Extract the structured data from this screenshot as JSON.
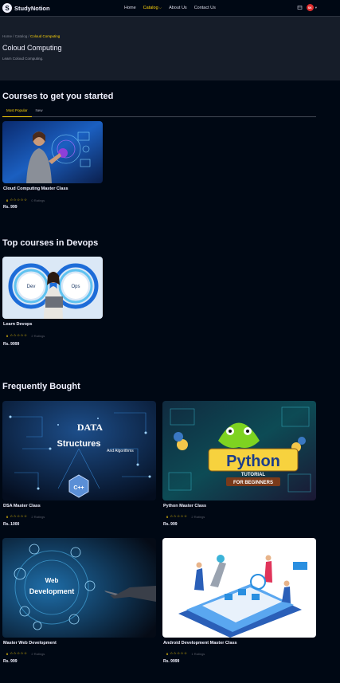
{
  "nav": {
    "logo_mark": "S",
    "logo_text": "StudyNotion",
    "links": [
      {
        "label": "Home"
      },
      {
        "label": "Catalog",
        "caret": "⌵"
      },
      {
        "label": "About Us"
      },
      {
        "label": "Contact Us"
      }
    ],
    "cart_icon": "cart-icon",
    "avatar_initials": "SK",
    "avatar_color": "#E02E2E"
  },
  "hero": {
    "breadcrumb_prefix": "Home / Catalog /",
    "breadcrumb_current": "Coloud Computing",
    "title": "Coloud Computing",
    "description": "Learn Coloud Computing."
  },
  "section1": {
    "title": "Courses to get you started",
    "tabs": [
      "Most Popular",
      "New"
    ],
    "active_tab": "Most Popular",
    "courses": [
      {
        "title": "Cloud Computing Master Class",
        "rating": "0",
        "stars": "☆☆☆☆☆",
        "ratings_text": "0 Ratings",
        "price": "Rs. 999"
      }
    ]
  },
  "section2": {
    "title": "Top courses in Devops",
    "courses": [
      {
        "title": "Learn Devops",
        "rating": "0",
        "stars": "☆☆☆☆☆",
        "ratings_text": "2 Ratings",
        "price": "Rs. 9999",
        "img_labels": [
          "Dev",
          "Ops"
        ]
      }
    ]
  },
  "section3": {
    "title": "Frequently Bought",
    "courses": [
      {
        "title": "DSA Master Class",
        "rating": "0",
        "stars": "☆☆☆☆☆",
        "ratings_text": "2 Ratings",
        "price": "Rs. 1000",
        "img_labels": [
          "DATA",
          "Structures",
          "And Algorithms",
          "C++"
        ]
      },
      {
        "title": "Python Master Class",
        "rating": "0",
        "stars": "☆☆☆☆☆",
        "ratings_text": "2 Ratings",
        "price": "Rs. 999",
        "img_labels": [
          "Python",
          "TUTORIAL",
          "FOR BEGINNERS"
        ]
      },
      {
        "title": "Master Web Development",
        "rating": "0",
        "stars": "☆☆☆☆☆",
        "ratings_text": "2 Ratings",
        "price": "Rs. 999",
        "img_labels": [
          "Web",
          "Development"
        ]
      },
      {
        "title": "Android Development Master Class",
        "rating": "0",
        "stars": "☆☆☆☆☆",
        "ratings_text": "1 Ratings",
        "price": "Rs. 9999"
      }
    ]
  },
  "colors": {
    "accent": "#FFD60A",
    "background": "#000814",
    "hero_bg": "#161D29"
  }
}
